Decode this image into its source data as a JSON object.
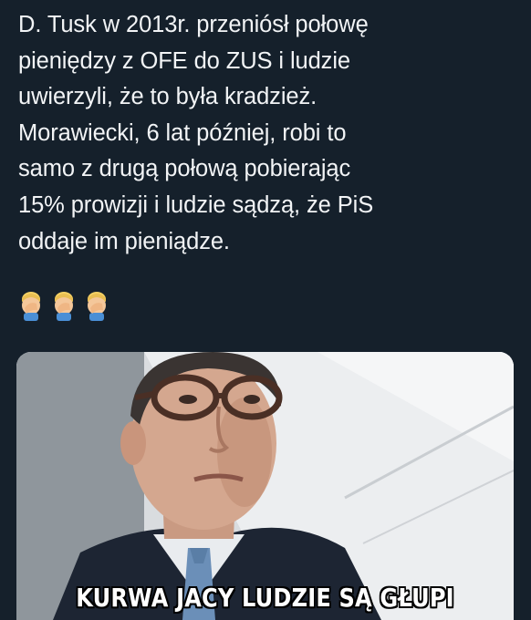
{
  "tweet": {
    "text": "D. Tusk w 2013r. przeniósł połowę\npieniędzy z OFE do ZUS i ludzie\nuwierzyli, że to była kradzież.\nMorawiecki, 6 lat później,  robi to\nsamo z drugą połową pobierając\n15% prowizji i ludzie sądzą, że PiS\noddaje im pieniądze.",
    "emojis": [
      "man-facepalming-icon",
      "man-facepalming-icon",
      "man-facepalming-icon"
    ]
  },
  "media": {
    "caption": "KURWA JACY LUDZIE SĄ GŁUPI"
  },
  "colors": {
    "background": "#15202b",
    "text": "#f2f4f6",
    "caption": "#ffffff"
  }
}
